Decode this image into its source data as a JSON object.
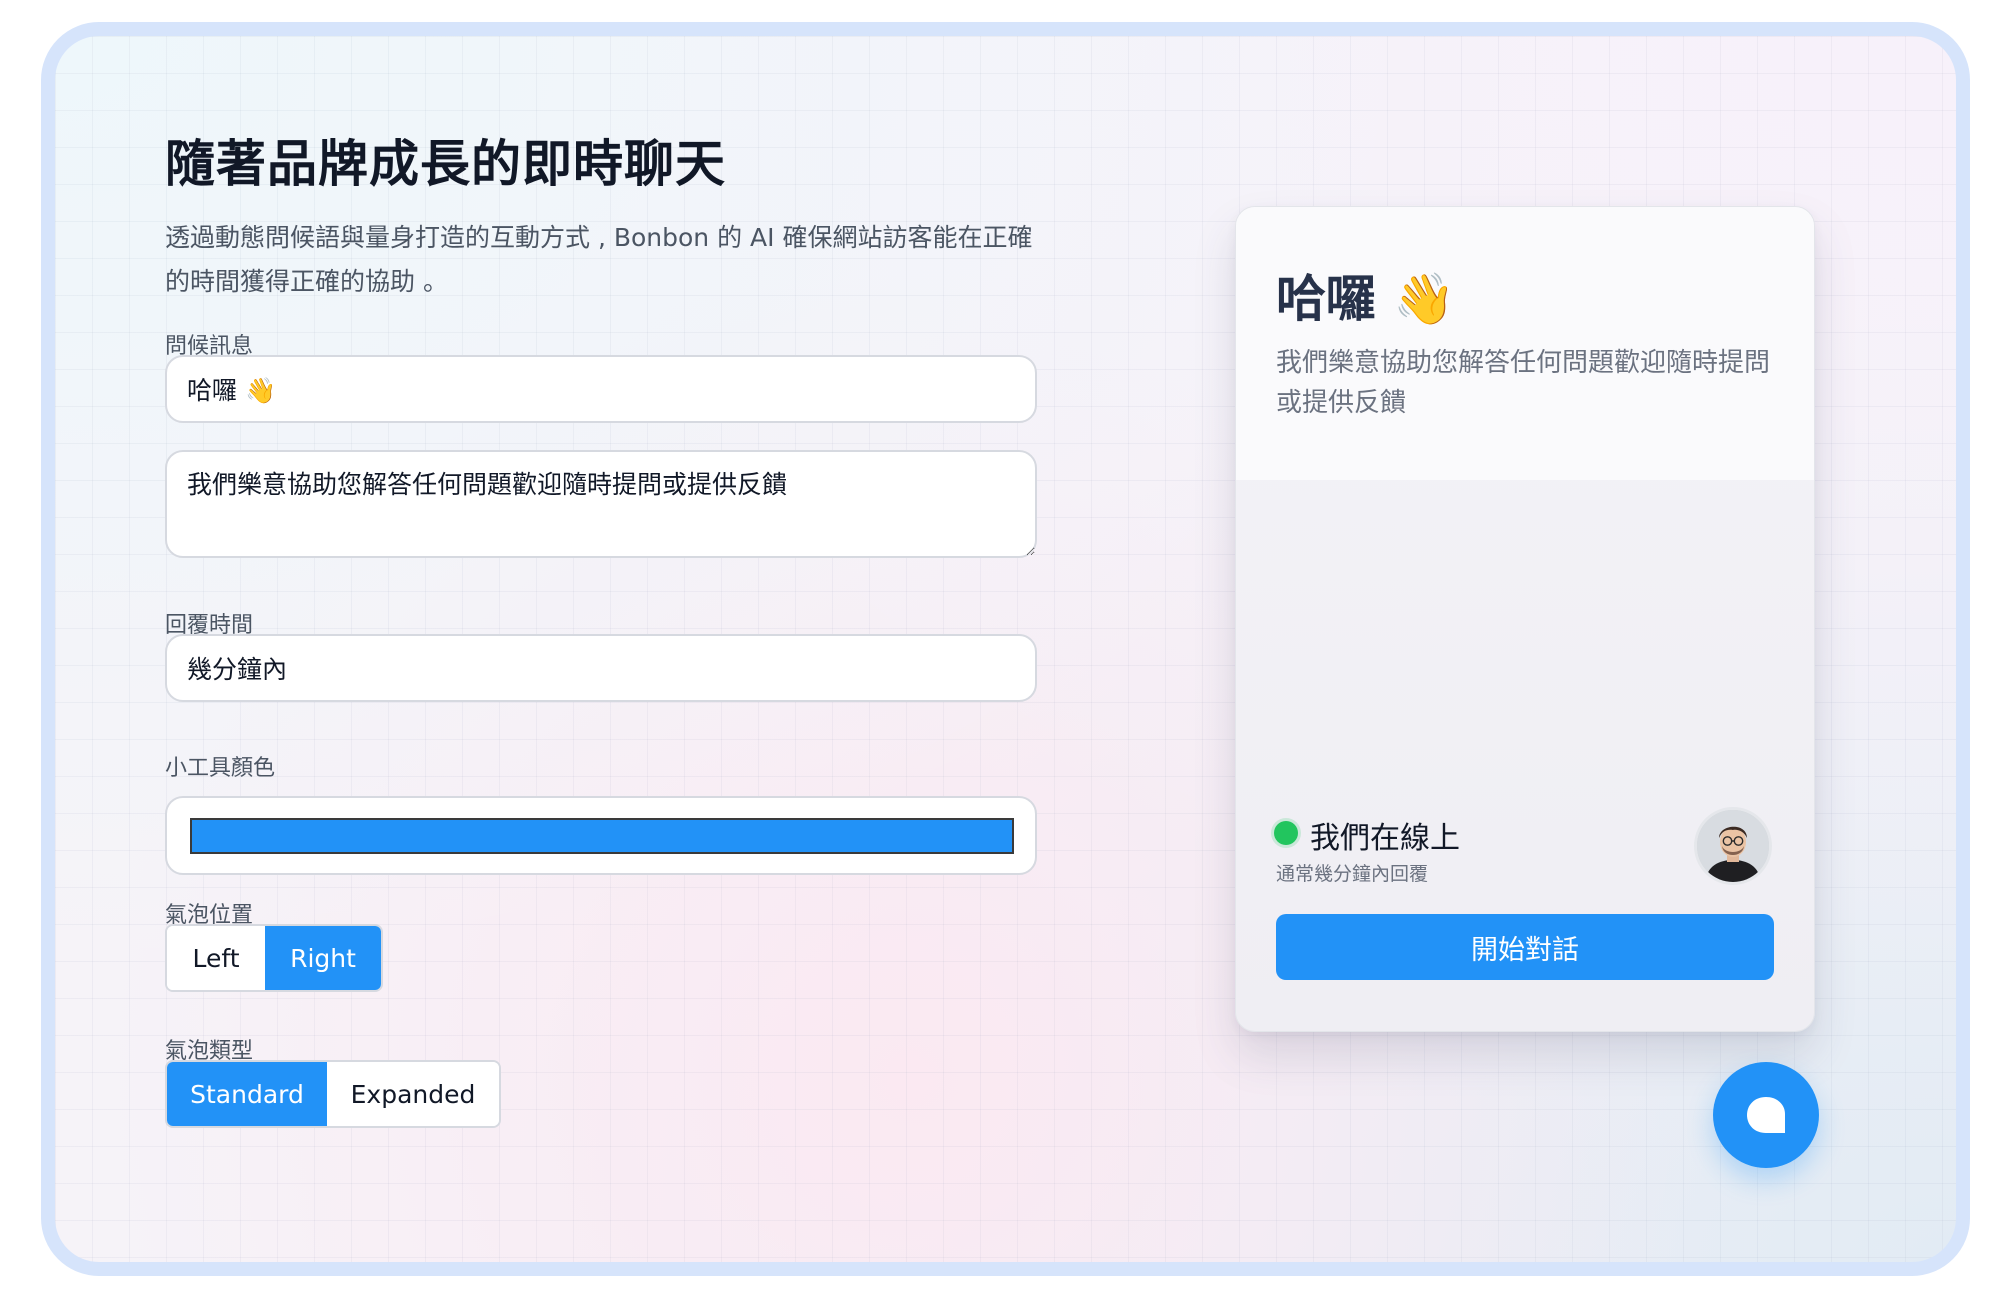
{
  "page": {
    "title": "隨著品牌成長的即時聊天",
    "description": "透過動態問候語與量身打造的互動方式 , Bonbon 的 AI 確保網站訪客能在正確的時間獲得正確的協助 。"
  },
  "form": {
    "greeting_label": "問候訊息",
    "greeting_title_value": "哈囉 👋",
    "greeting_message_value": "我們樂意協助您解答任何問題歡迎隨時提問或提供反饋",
    "reply_time_label": "回覆時間",
    "reply_time_value": "幾分鐘內",
    "widget_color_label": "小工具顏色",
    "widget_color": "#2292f7",
    "bubble_position_label": "氣泡位置",
    "bubble_position_options": [
      "Left",
      "Right"
    ],
    "bubble_position_selected": "Right",
    "bubble_type_label": "氣泡類型",
    "bubble_type_options": [
      "Standard",
      "Expanded"
    ],
    "bubble_type_selected": "Standard"
  },
  "preview": {
    "title": "哈囉 👋",
    "subtitle": "我們樂意協助您解答任何問題歡迎隨時提問或提供反饋",
    "status": "我們在線上",
    "status_sub": "通常幾分鐘內回覆",
    "start_button": "開始對話",
    "status_color": "#22c55e"
  },
  "launcher": {
    "icon": "chat-bubble-icon"
  },
  "colors": {
    "accent": "#2292f7",
    "frame_border": "#d6e4fb"
  }
}
